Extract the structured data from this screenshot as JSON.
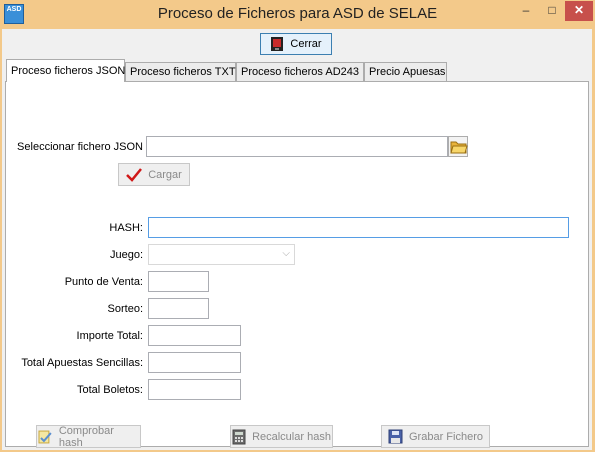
{
  "window": {
    "icon_text": "ASD",
    "title": "Proceso de Ficheros para ASD de SELAE",
    "minimize": "–",
    "maximize": "□",
    "close": "✕"
  },
  "toolbar": {
    "close_label": "Cerrar"
  },
  "tabs": [
    {
      "label": "Proceso ficheros JSON",
      "active": true
    },
    {
      "label": "Proceso ficheros TXT",
      "active": false
    },
    {
      "label": "Proceso ficheros AD243",
      "active": false
    },
    {
      "label": "Precio Apuesas",
      "active": false
    }
  ],
  "form": {
    "select_file_label": "Seleccionar fichero JSON",
    "select_file_value": "",
    "load_button": "Cargar",
    "hash_label": "HASH:",
    "hash_value": "",
    "game_label": "Juego:",
    "game_value": "",
    "point_of_sale_label": "Punto de Venta:",
    "point_of_sale_value": "",
    "draw_label": "Sorteo:",
    "draw_value": "",
    "total_amount_label": "Importe Total:",
    "total_amount_value": "",
    "total_single_bets_label": "Total Apuestas Sencillas:",
    "total_single_bets_value": "",
    "total_tickets_label": "Total Boletos:",
    "total_tickets_value": ""
  },
  "actions": {
    "check_hash": "Comprobar hash",
    "recalculate_hash": "Recalcular hash",
    "save_file": "Grabar Fichero"
  },
  "colors": {
    "titlebar": "#f3c98a",
    "close_button": "#c7504b",
    "focus_border": "#569de5"
  }
}
